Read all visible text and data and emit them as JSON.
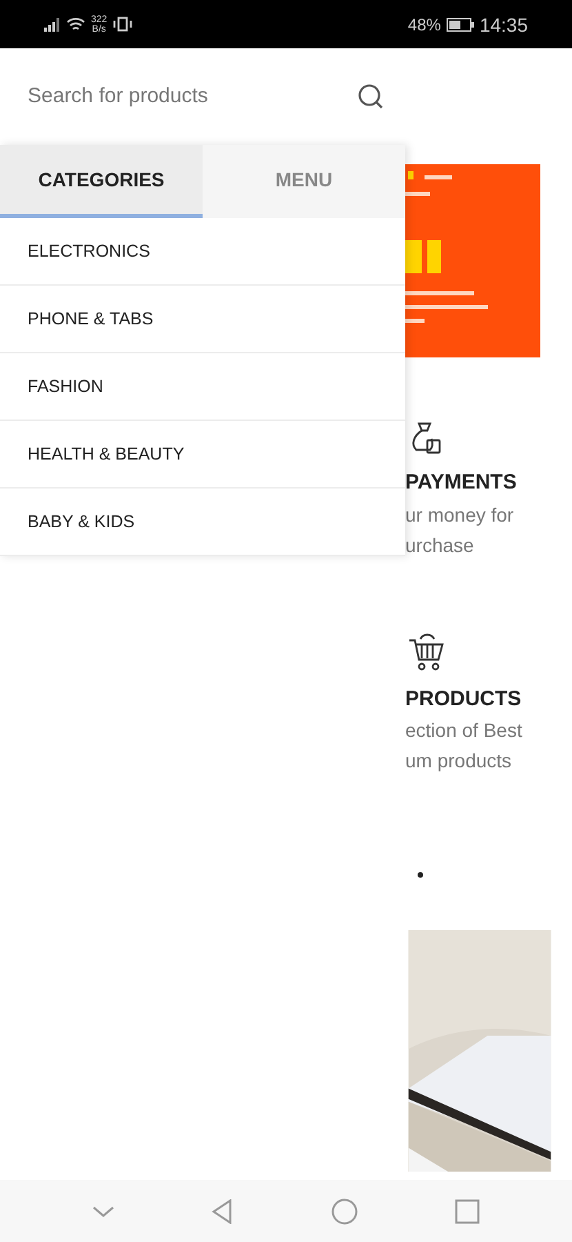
{
  "status_bar": {
    "speed": "322",
    "speed_unit": "B/s",
    "battery": "48%",
    "time": "14:35"
  },
  "search": {
    "placeholder": "Search for products"
  },
  "tabs": [
    {
      "label": "CATEGORIES",
      "selected": true
    },
    {
      "label": "MENU",
      "selected": false
    }
  ],
  "categories": [
    {
      "label": "ELECTRONICS"
    },
    {
      "label": "PHONE & TABS"
    },
    {
      "label": "FASHION"
    },
    {
      "label": "HEALTH & BEAUTY"
    },
    {
      "label": "BABY & KIDS"
    }
  ],
  "features": [
    {
      "kind": "payments",
      "title": "PAYMENTS",
      "lines": [
        "ur money for",
        "urchase"
      ]
    },
    {
      "kind": "products",
      "title": "PRODUCTS",
      "lines": [
        "ection of Best",
        "um products"
      ]
    }
  ]
}
